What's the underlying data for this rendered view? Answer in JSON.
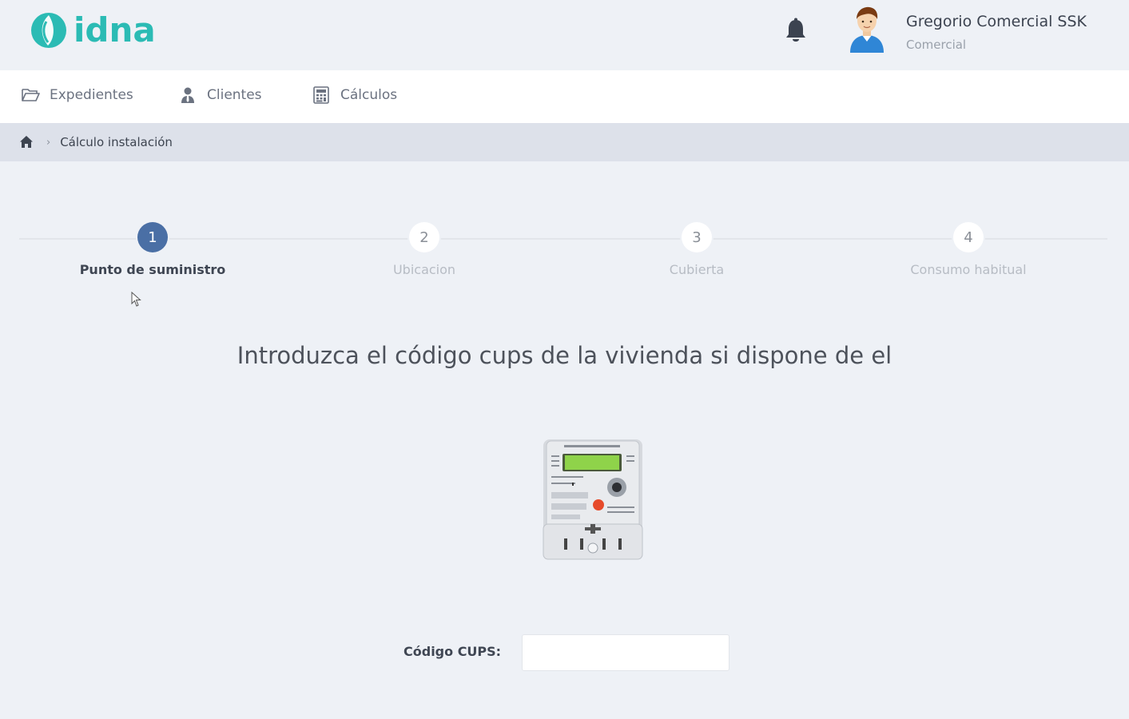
{
  "brand": {
    "name": "idna",
    "color": "#2bbbb4"
  },
  "header": {
    "notifications_icon": "bell-icon",
    "user": {
      "name": "Gregorio Comercial SSK",
      "role": "Comercial",
      "avatar_icon": "user-avatar"
    }
  },
  "nav": {
    "items": [
      {
        "label": "Expedientes",
        "icon": "folder-open-icon"
      },
      {
        "label": "Clientes",
        "icon": "user-tie-icon"
      },
      {
        "label": "Cálculos",
        "icon": "calculator-icon"
      }
    ]
  },
  "breadcrumb": {
    "home_icon": "home-icon",
    "separator": "›",
    "current": "Cálculo instalación"
  },
  "stepper": {
    "active_step": 1,
    "active_color": "#4a6fa5",
    "steps": [
      {
        "number": "1",
        "label": "Punto de suministro"
      },
      {
        "number": "2",
        "label": "Ubicacion"
      },
      {
        "number": "3",
        "label": "Cubierta"
      },
      {
        "number": "4",
        "label": "Consumo habitual"
      }
    ]
  },
  "main": {
    "heading": "Introduzca el código cups de la vivienda si dispone de el",
    "image_icon": "electric-meter-image",
    "cups_label": "Código CUPS:",
    "cups_value": "",
    "cups_placeholder": ""
  }
}
